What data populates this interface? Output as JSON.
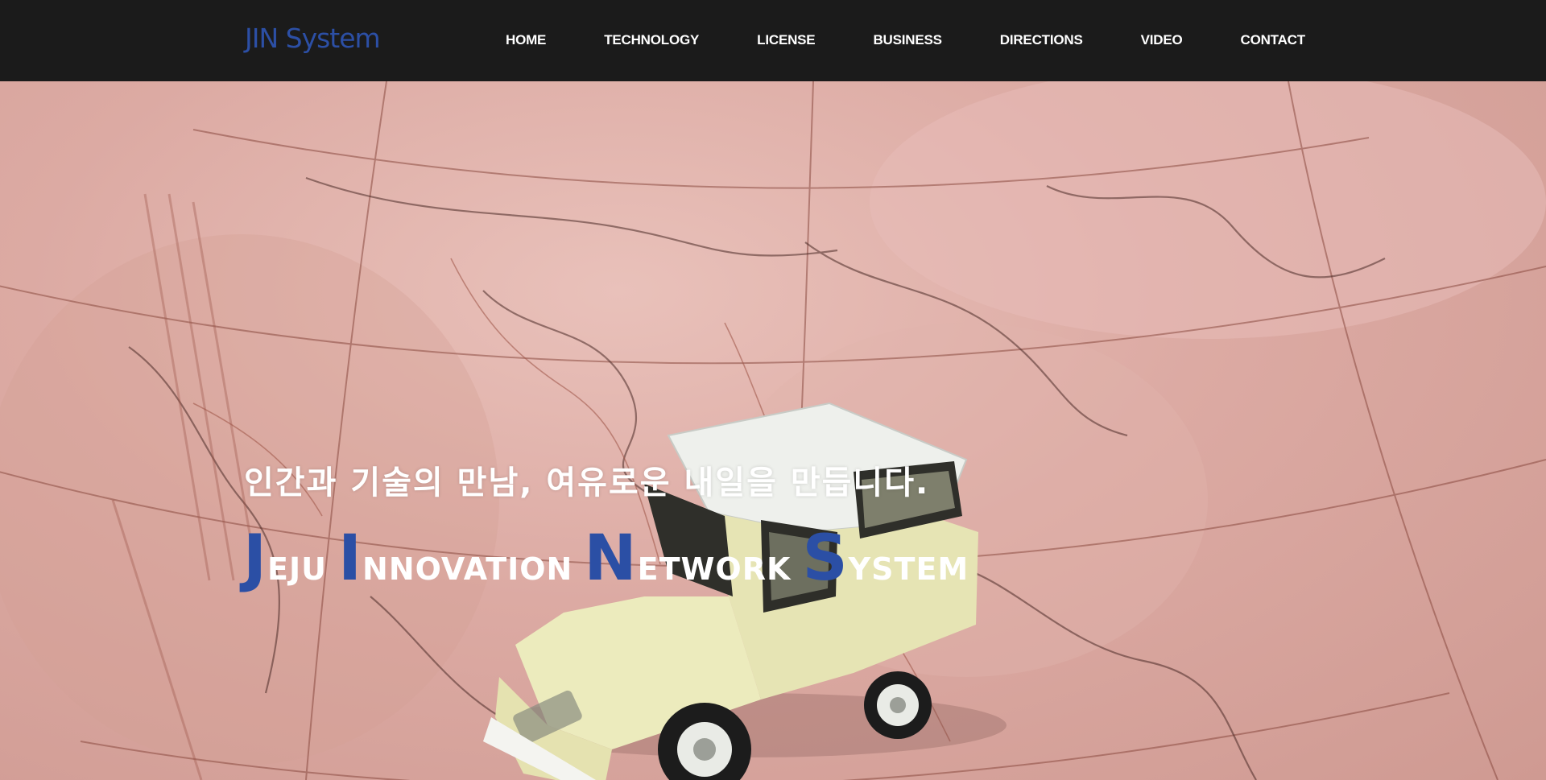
{
  "header": {
    "logo": "JIN System",
    "nav": [
      {
        "label": "HOME"
      },
      {
        "label": "TECHNOLOGY"
      },
      {
        "label": "LICENSE"
      },
      {
        "label": "BUSINESS"
      },
      {
        "label": "DIRECTIONS"
      },
      {
        "label": "VIDEO"
      },
      {
        "label": "CONTACT"
      }
    ]
  },
  "hero": {
    "tagline": "인간과 기술의 만남, 여유로운 내일을 만듭니다.",
    "slogan": [
      {
        "cap": "J",
        "rest": "EJU"
      },
      {
        "cap": "I",
        "rest": "NNOVATION"
      },
      {
        "cap": "N",
        "rest": "ETWORK"
      },
      {
        "cap": "S",
        "rest": "YSTEM"
      }
    ]
  },
  "colors": {
    "nav_background": "#1b1b1b",
    "brand_blue": "#2c4fa5",
    "map_pink": "#dcaaa3",
    "car_body": "#ecebbd",
    "car_roof": "#eef0ec"
  }
}
